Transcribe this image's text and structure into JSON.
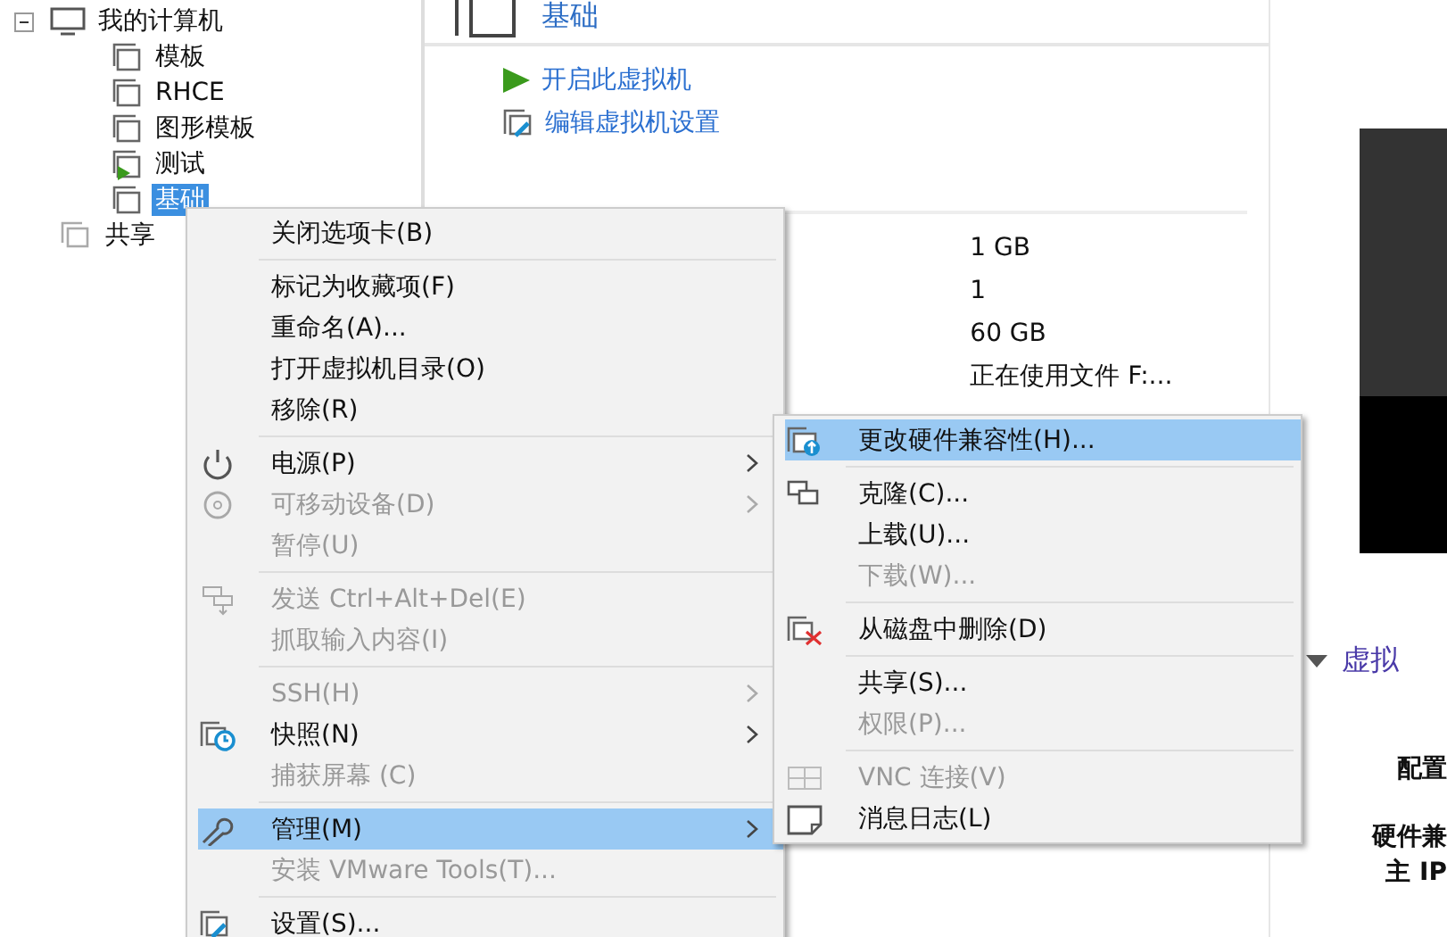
{
  "tree": {
    "root": {
      "label": "我的计算机",
      "expanded": true,
      "children": [
        {
          "label": "模板",
          "selected": false,
          "running": false
        },
        {
          "label": "RHCE",
          "selected": false,
          "running": false
        },
        {
          "label": "图形模板",
          "selected": false,
          "running": false
        },
        {
          "label": "测试",
          "selected": false,
          "running": true
        },
        {
          "label": "基础",
          "selected": true,
          "running": false
        }
      ]
    },
    "shared": {
      "label": "共享"
    }
  },
  "vm": {
    "title": "基础",
    "actions": [
      {
        "kind": "start",
        "label": "开启此虚拟机"
      },
      {
        "kind": "edit",
        "label": "编辑虚拟机设置"
      }
    ],
    "device_values": [
      "1 GB",
      "1",
      "60 GB",
      "正在使用文件 F:..."
    ],
    "details_heading": "虚拟",
    "details_labels": [
      "配置",
      "硬件兼",
      "主 IP"
    ]
  },
  "context_menu": [
    {
      "label": "关闭选项卡(B)",
      "disabled": false,
      "selected": false,
      "submenu": false,
      "separator_before": false
    },
    {
      "label": "标记为收藏项(F)",
      "disabled": false,
      "selected": false,
      "submenu": false,
      "separator_before": true
    },
    {
      "label": "重命名(A)...",
      "disabled": false,
      "selected": false,
      "submenu": false,
      "separator_before": false
    },
    {
      "label": "打开虚拟机目录(O)",
      "disabled": false,
      "selected": false,
      "submenu": false,
      "separator_before": false
    },
    {
      "label": "移除(R)",
      "disabled": false,
      "selected": false,
      "submenu": false,
      "separator_before": false
    },
    {
      "label": "电源(P)",
      "disabled": false,
      "selected": false,
      "submenu": true,
      "separator_before": true
    },
    {
      "label": "可移动设备(D)",
      "disabled": true,
      "selected": false,
      "submenu": true,
      "separator_before": false
    },
    {
      "label": "暂停(U)",
      "disabled": true,
      "selected": false,
      "submenu": false,
      "separator_before": false
    },
    {
      "label": "发送 Ctrl+Alt+Del(E)",
      "disabled": true,
      "selected": false,
      "submenu": false,
      "separator_before": true
    },
    {
      "label": "抓取输入内容(I)",
      "disabled": true,
      "selected": false,
      "submenu": false,
      "separator_before": false
    },
    {
      "label": "SSH(H)",
      "disabled": true,
      "selected": false,
      "submenu": true,
      "separator_before": true
    },
    {
      "label": "快照(N)",
      "disabled": false,
      "selected": false,
      "submenu": true,
      "separator_before": false
    },
    {
      "label": "捕获屏幕 (C)",
      "disabled": true,
      "selected": false,
      "submenu": false,
      "separator_before": false
    },
    {
      "label": "管理(M)",
      "disabled": false,
      "selected": true,
      "submenu": true,
      "separator_before": true
    },
    {
      "label": "安装 VMware Tools(T)...",
      "disabled": true,
      "selected": false,
      "submenu": false,
      "separator_before": false
    },
    {
      "label": "设置(S)...",
      "disabled": false,
      "selected": false,
      "submenu": false,
      "separator_before": true
    }
  ],
  "submenu": [
    {
      "label": "更改硬件兼容性(H)...",
      "disabled": false,
      "selected": true,
      "separator_before": false
    },
    {
      "label": "克隆(C)...",
      "disabled": false,
      "selected": false,
      "separator_before": true
    },
    {
      "label": "上载(U)...",
      "disabled": false,
      "selected": false,
      "separator_before": false
    },
    {
      "label": "下载(W)...",
      "disabled": true,
      "selected": false,
      "separator_before": false
    },
    {
      "label": "从磁盘中删除(D)",
      "disabled": false,
      "selected": false,
      "separator_before": true
    },
    {
      "label": "共享(S)...",
      "disabled": false,
      "selected": false,
      "separator_before": true
    },
    {
      "label": "权限(P)...",
      "disabled": true,
      "selected": false,
      "separator_before": false
    },
    {
      "label": "VNC 连接(V)",
      "disabled": true,
      "selected": false,
      "separator_before": true
    },
    {
      "label": "消息日志(L)",
      "disabled": false,
      "selected": false,
      "separator_before": false
    }
  ]
}
